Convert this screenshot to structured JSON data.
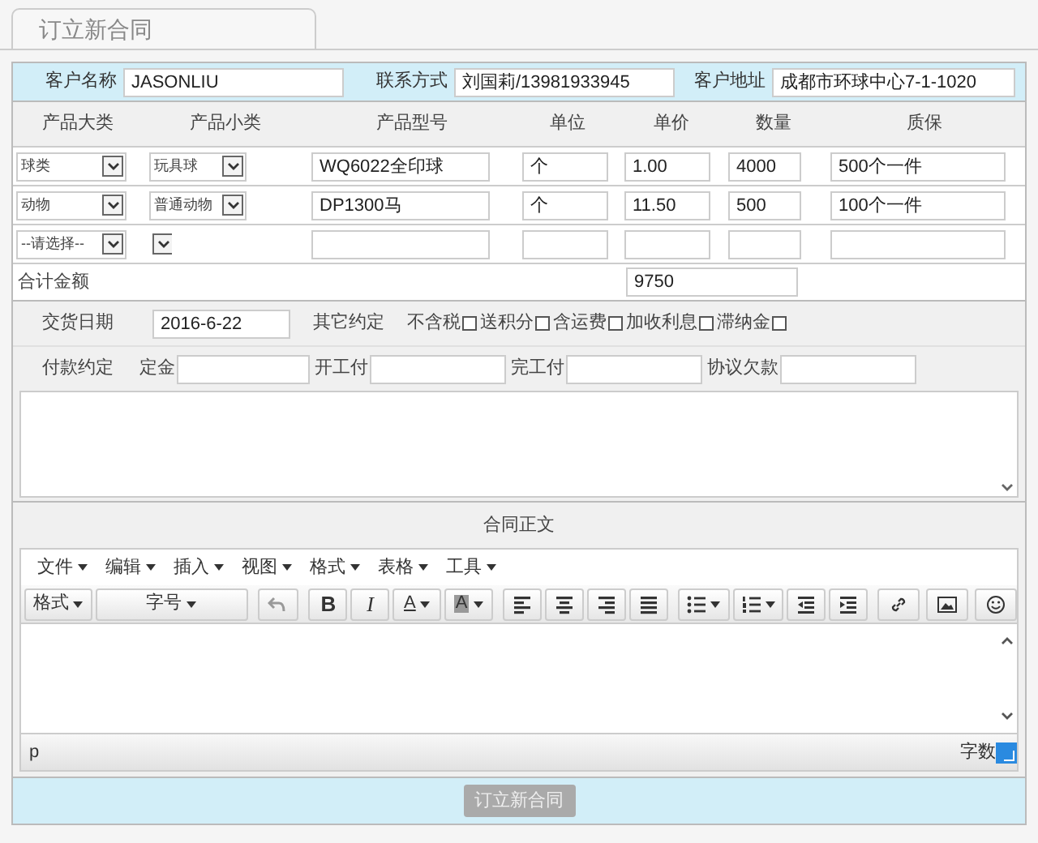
{
  "tab": {
    "label": "订立新合同",
    "selected": true
  },
  "customer": [
    {
      "label": "客户名称",
      "value": "JASONLIU"
    },
    {
      "label": "联系方式",
      "value": "刘国莉/13981933945"
    },
    {
      "label": "客户地址",
      "value": "成都市环球中心7-1-1020"
    }
  ],
  "table": {
    "columns": [
      "产品大类",
      "产品小类",
      "产品型号",
      "单位",
      "单价",
      "数量",
      "质保"
    ],
    "rows": [
      {
        "category": "球类",
        "subcategory": "玩具球",
        "model": "WQ6022全印球",
        "unit": "个",
        "price": "1.00",
        "quantity": "4000",
        "warranty": "500个一件"
      },
      {
        "category": "动物",
        "subcategory": "普通动物",
        "model": "DP1300马",
        "unit": "个",
        "price": "11.50",
        "quantity": "500",
        "warranty": "100个一件"
      },
      {
        "category": "--请选择--"
      }
    ]
  },
  "total": {
    "label": "合计金额",
    "value": "9750"
  },
  "delivery": {
    "label": "交货日期",
    "value": "2016-6-22",
    "terms_label": "其它约定",
    "options": [
      {
        "label": "不含税",
        "checked": false
      },
      {
        "label": "送积分",
        "checked": false
      },
      {
        "label": "含运费",
        "checked": false
      },
      {
        "label": "加收利息",
        "checked": false
      },
      {
        "label": "滞纳金",
        "checked": false
      }
    ]
  },
  "payment": {
    "label": "付款约定",
    "fields": [
      {
        "label": "定金"
      },
      {
        "label": "开工付"
      },
      {
        "label": "完工付"
      },
      {
        "label": "协议欠款"
      }
    ]
  },
  "editor": {
    "title": "合同正文",
    "menus": [
      "文件",
      "编辑",
      "插入",
      "视图",
      "格式",
      "表格",
      "工具"
    ],
    "format_dropdown": "格式",
    "size_dropdown": "字号",
    "bold": "B",
    "italic": "I",
    "text_color": "A",
    "background_color": "A",
    "path": "p",
    "word_count": "字数"
  },
  "submit": {
    "label": "订立新合同",
    "disabled": true
  }
}
